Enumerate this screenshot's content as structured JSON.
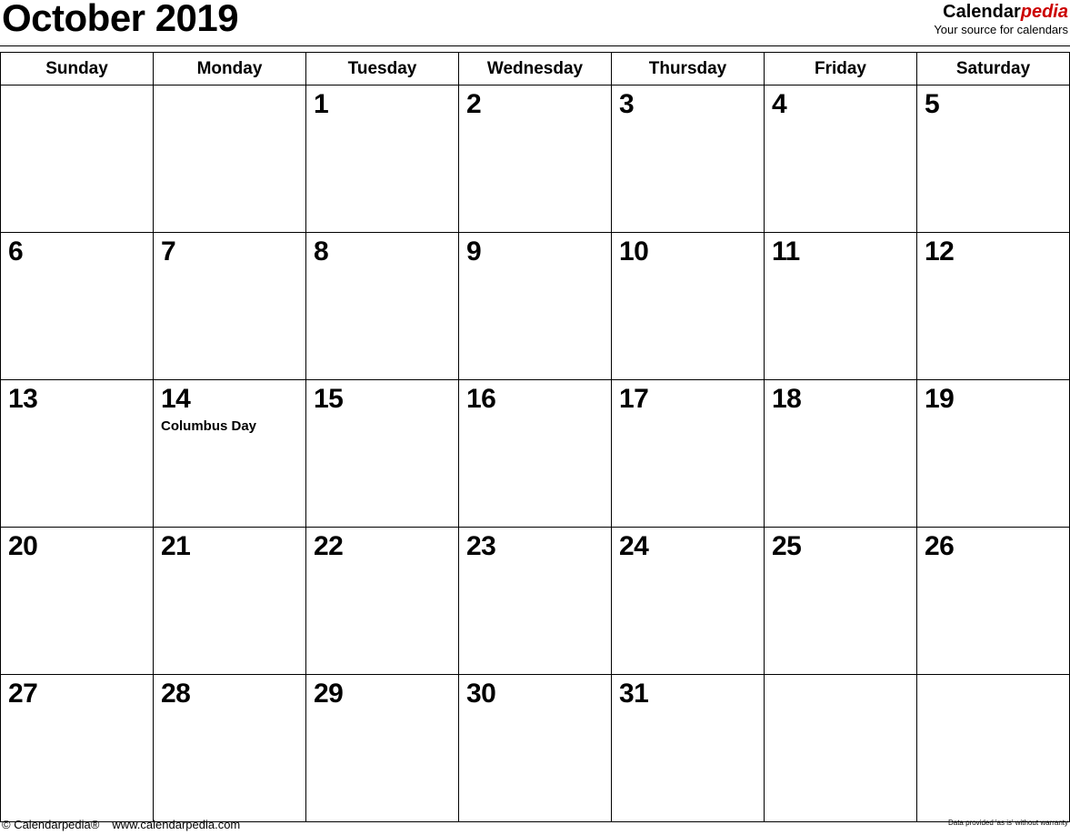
{
  "header": {
    "title": "October 2019",
    "brand": {
      "name_part1": "Calendar",
      "name_part2": "pedia",
      "tagline": "Your source for calendars",
      "accent_color": "#cc0000"
    }
  },
  "calendar": {
    "month": "October",
    "year": "2019",
    "weekday_headers": [
      "Sunday",
      "Monday",
      "Tuesday",
      "Wednesday",
      "Thursday",
      "Friday",
      "Saturday"
    ],
    "colors": {
      "sunday": "#fc8585",
      "saturday": "#9acdfc",
      "weekday": "#ffffff",
      "holiday": "#fc8585",
      "border": "#000000"
    },
    "weeks": [
      [
        {
          "day": "",
          "event": ""
        },
        {
          "day": "",
          "event": ""
        },
        {
          "day": "1",
          "event": ""
        },
        {
          "day": "2",
          "event": ""
        },
        {
          "day": "3",
          "event": ""
        },
        {
          "day": "4",
          "event": ""
        },
        {
          "day": "5",
          "event": ""
        }
      ],
      [
        {
          "day": "6",
          "event": ""
        },
        {
          "day": "7",
          "event": ""
        },
        {
          "day": "8",
          "event": ""
        },
        {
          "day": "9",
          "event": ""
        },
        {
          "day": "10",
          "event": ""
        },
        {
          "day": "11",
          "event": ""
        },
        {
          "day": "12",
          "event": ""
        }
      ],
      [
        {
          "day": "13",
          "event": ""
        },
        {
          "day": "14",
          "event": "Columbus Day"
        },
        {
          "day": "15",
          "event": ""
        },
        {
          "day": "16",
          "event": ""
        },
        {
          "day": "17",
          "event": ""
        },
        {
          "day": "18",
          "event": ""
        },
        {
          "day": "19",
          "event": ""
        }
      ],
      [
        {
          "day": "20",
          "event": ""
        },
        {
          "day": "21",
          "event": ""
        },
        {
          "day": "22",
          "event": ""
        },
        {
          "day": "23",
          "event": ""
        },
        {
          "day": "24",
          "event": ""
        },
        {
          "day": "25",
          "event": ""
        },
        {
          "day": "26",
          "event": ""
        }
      ],
      [
        {
          "day": "27",
          "event": ""
        },
        {
          "day": "28",
          "event": ""
        },
        {
          "day": "29",
          "event": ""
        },
        {
          "day": "30",
          "event": ""
        },
        {
          "day": "31",
          "event": ""
        },
        {
          "day": "",
          "event": ""
        },
        {
          "day": "",
          "event": ""
        }
      ]
    ]
  },
  "footer": {
    "copyright": "© Calendarpedia®",
    "url": "www.calendarpedia.com",
    "disclaimer": "Data provided 'as is' without warranty"
  }
}
